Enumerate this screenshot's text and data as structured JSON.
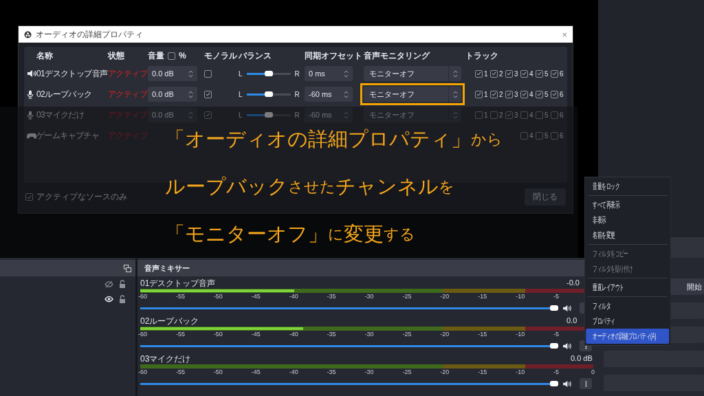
{
  "dialog": {
    "title": "オーディオの詳細プロパティ",
    "close": "×",
    "columns": [
      "名称",
      "状態",
      "音量",
      "モノラル",
      "バランス",
      "同期オフセット",
      "音声モニタリング",
      "トラック"
    ],
    "percent": {
      "label": "%",
      "checked": false
    },
    "rows": [
      {
        "kind": "speaker",
        "name": "01デスクトップ音声",
        "status": "アクティブ",
        "volume": "0.0 dB",
        "mono": false,
        "balance": {
          "left": "L",
          "right": "R",
          "level": 0.5
        },
        "offset": "0 ms",
        "monitoring": "モニターオフ",
        "tracks": [
          {
            "label": "1",
            "checked": true
          },
          {
            "label": "2",
            "checked": true
          },
          {
            "label": "3",
            "checked": true
          },
          {
            "label": "4",
            "checked": true
          },
          {
            "label": "5",
            "checked": true
          },
          {
            "label": "6",
            "checked": true
          }
        ]
      },
      {
        "kind": "mic",
        "name": "02ループバック",
        "status": "アクティブ",
        "volume": "0.0 dB",
        "mono": true,
        "balance": {
          "left": "L",
          "right": "R",
          "level": 0.5
        },
        "offset": "-60 ms",
        "monitoring": "モニターオフ",
        "highlighted": true,
        "tracks": [
          {
            "label": "1",
            "checked": true
          },
          {
            "label": "2",
            "checked": true
          },
          {
            "label": "3",
            "checked": true
          },
          {
            "label": "4",
            "checked": true
          },
          {
            "label": "5",
            "checked": true
          },
          {
            "label": "6",
            "checked": true
          }
        ]
      },
      {
        "kind": "mic",
        "name": "03マイクだけ",
        "status": "アクティブ",
        "volume": "0.0 dB",
        "mono": true,
        "balance": {
          "left": "L",
          "right": "R",
          "level": 0.5
        },
        "offset": "-60 ms",
        "monitoring": "モニターオフ",
        "tracks": [
          {
            "label": "1",
            "checked": false
          },
          {
            "label": "2",
            "checked": false
          },
          {
            "label": "3",
            "checked": true
          },
          {
            "label": "4",
            "checked": false
          },
          {
            "label": "5",
            "checked": false
          },
          {
            "label": "6",
            "checked": false
          }
        ]
      },
      {
        "kind": "gamepad",
        "name": "ゲームキャプチャ",
        "status": "アクティブ",
        "tracks": [
          {
            "label": "4",
            "checked": false
          },
          {
            "label": "5",
            "checked": false
          },
          {
            "label": "6",
            "checked": false
          }
        ]
      }
    ],
    "footer": {
      "active_only": {
        "label": "アクティブなソースのみ",
        "checked": true
      },
      "close_button": "閉じる"
    }
  },
  "caption": {
    "lines": [
      [
        {
          "text": "「オーディオの詳細プロパティ」",
          "kind": "large"
        },
        {
          "text": "から",
          "kind": "small"
        }
      ],
      [
        {
          "text": "ループバック",
          "kind": "large"
        },
        {
          "text": "させた",
          "kind": "small"
        },
        {
          "text": "チャンネル",
          "kind": "large"
        },
        {
          "text": "を",
          "kind": "small"
        }
      ],
      [
        {
          "text": "「モニターオフ」",
          "kind": "large"
        },
        {
          "text": "に",
          "kind": "small"
        },
        {
          "text": "変更",
          "kind": "large"
        },
        {
          "text": "する",
          "kind": "small"
        }
      ]
    ]
  },
  "sources": {
    "items": [
      {
        "visible": false,
        "locked": false
      },
      {
        "visible": true,
        "locked": false
      }
    ]
  },
  "mixer": {
    "title": "音声ミキサー",
    "channels": [
      {
        "name": "01デスクトップ音声",
        "reading": "-0.0",
        "level": 0.34,
        "volume": {
          "level": 1
        },
        "ticks": [
          "-60",
          "-55",
          "-50",
          "-45",
          "-40",
          "-35",
          "-30",
          "-25",
          "-20",
          "-15",
          "-10",
          "-5"
        ]
      },
      {
        "name": "02ループバック",
        "reading": "0.0",
        "level": 0.36,
        "volume": {
          "level": 1
        },
        "ticks": [
          "-60",
          "-55",
          "-50",
          "-45",
          "-40",
          "-35",
          "-30",
          "-25",
          "-20",
          "-15",
          "-10",
          "-5"
        ]
      },
      {
        "name": "03マイクだけ",
        "reading": "0.0 dB",
        "level": 0,
        "volume": {
          "level": 1
        },
        "ticks": [
          "-60",
          "-55",
          "-50",
          "-45",
          "-40",
          "-35",
          "-30",
          "-25",
          "-20",
          "-15",
          "-10",
          "-5",
          "0"
        ]
      }
    ]
  },
  "controls": {
    "buttons": [
      "開始"
    ]
  },
  "context_menu": {
    "items": [
      {
        "kind": "item",
        "label": "音量をロック",
        "disabled": false,
        "selected": false
      },
      {
        "kind": "separator"
      },
      {
        "kind": "item",
        "label": "すべて再表示",
        "disabled": false,
        "selected": false
      },
      {
        "kind": "item",
        "label": "非表示",
        "disabled": false,
        "selected": false
      },
      {
        "kind": "item",
        "label": "名前を変更",
        "disabled": false,
        "selected": false
      },
      {
        "kind": "separator"
      },
      {
        "kind": "item",
        "label": "フィルタをコピー",
        "disabled": true,
        "selected": false
      },
      {
        "kind": "item",
        "label": "フィルタを貼り付け",
        "disabled": true,
        "selected": false
      },
      {
        "kind": "separator"
      },
      {
        "kind": "item",
        "label": "垂直レイアウト",
        "disabled": false,
        "selected": false
      },
      {
        "kind": "separator"
      },
      {
        "kind": "item",
        "label": "フィルタ",
        "disabled": false,
        "selected": false
      },
      {
        "kind": "item",
        "label": "プロパティ",
        "disabled": false,
        "selected": false
      },
      {
        "kind": "item",
        "label": "オーディオの詳細プロパティ(A)",
        "disabled": false,
        "selected": true
      }
    ]
  }
}
